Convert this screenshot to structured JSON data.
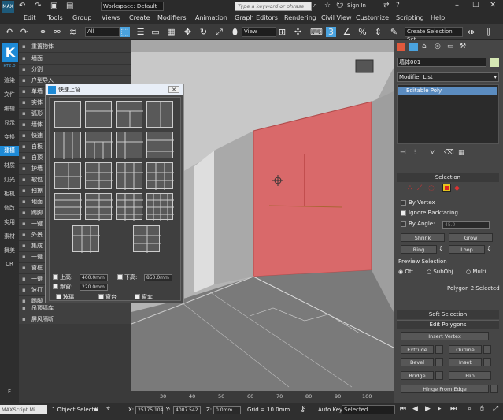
{
  "window": {
    "workspace": "Workspace: Default",
    "search_placeholder": "Type a keyword or phrase",
    "sign_in": "Sign In"
  },
  "menu": [
    "Edit",
    "Tools",
    "Group",
    "Views",
    "Create",
    "Modifiers",
    "Animation",
    "Graph Editors",
    "Rendering",
    "Civil View",
    "Customize",
    "Scripting",
    "Help"
  ],
  "toolbar": {
    "filter": "All",
    "view": "View",
    "selection_set": "Create Selection Set"
  },
  "left_strip": {
    "logo": "K",
    "version": "KT2.0",
    "items": [
      "渲染",
      "文件",
      "编辑",
      "显示",
      "变换",
      "建模",
      "材质",
      "灯光",
      "相机",
      "修改",
      "实用",
      "素材",
      "舞美",
      "CR"
    ],
    "bottom": "F"
  },
  "plugin_rows": [
    "重置物体",
    "墙面",
    "分割",
    "户型导入",
    "单墙",
    "实体",
    "弧形",
    "墙体",
    "快速",
    "白板",
    "白顶",
    "护墙",
    "软包",
    "扫掠",
    "地面",
    "踢脚",
    "一键",
    "外景",
    "集成",
    "一键",
    "窗框",
    "一键",
    "波打",
    "踢脚",
    "吊顶墙库",
    "屏风隔断"
  ],
  "dialog": {
    "title": "快速上窗",
    "top_label": "上高:",
    "top_value": "400.0mm",
    "bottom_label": "下高:",
    "bottom_value": "850.0mm",
    "bay_label": "飘窗:",
    "bay_value": "220.0mm",
    "glass": "玻璃",
    "sill": "窗台",
    "cover": "窗套"
  },
  "command_panel": {
    "object_name": "墙体001",
    "modifier_list": "Modifier List",
    "stack_item": "Editable Poly",
    "selection_title": "Selection",
    "by_vertex": "By Vertex",
    "ignore_backfacing": "Ignore Backfacing",
    "by_angle": "By Angle:",
    "angle_value": "45.0",
    "shrink": "Shrink",
    "grow": "Grow",
    "ring": "Ring",
    "loop": "Loop",
    "preview_selection": "Preview Selection",
    "off": "Off",
    "subobj": "SubObj",
    "multi": "Multi",
    "selected_info": "Polygon 2 Selected",
    "soft_selection": "Soft Selection",
    "edit_polygons": "Edit Polygons",
    "insert_vertex": "Insert Vertex",
    "extrude": "Extrude",
    "outline": "Outline",
    "bevel": "Bevel",
    "inset": "Inset",
    "bridge": "Bridge",
    "flip": "Flip",
    "hinge": "Hinge From Edge"
  },
  "ruler_ticks": [
    "30",
    "40",
    "50",
    "60",
    "70",
    "80",
    "90",
    "100"
  ],
  "status": {
    "maxscript": "MAXScript Mi",
    "selected": "1 Object Selecte",
    "x_label": "X:",
    "x_value": "25175.104",
    "y_label": "Y:",
    "y_value": "4007.542",
    "z_label": "Z:",
    "z_value": "0.0mm",
    "grid": "Grid = 10.0mm",
    "auto_key": "Auto Key",
    "set_key": "Selected"
  },
  "colors": {
    "selected_face": "#d9696a",
    "accent": "#4aa3df"
  }
}
